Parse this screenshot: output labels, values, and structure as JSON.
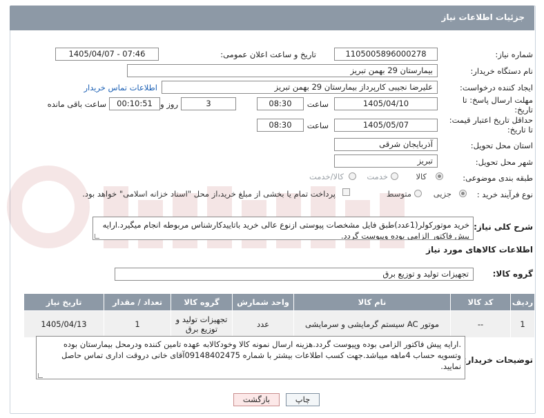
{
  "header": {
    "title": "جزئیات اطلاعات نیاز"
  },
  "form": {
    "need_number": {
      "label": "شماره نیاز:",
      "value": "1105005896000278"
    },
    "announce_datetime": {
      "label": "تاریخ و ساعت اعلان عمومی:",
      "value": "1405/04/07 - 07:46"
    },
    "buyer_device": {
      "label": "نام دستگاه خریدار:",
      "value": "بیمارستان 29 بهمن تبریز"
    },
    "requester": {
      "label": "ایجاد کننده درخواست:",
      "value": "علیرضا نجیبی کارپرداز بیمارستان 29 بهمن تبریز",
      "contact_link": "اطلاعات تماس خریدار"
    },
    "reply_deadline": {
      "label_line1": "مهلت ارسال پاسخ: تا",
      "label_line2": "تاریخ:",
      "date": "1405/04/10",
      "time_label": "ساعت",
      "time": "08:30",
      "days": "3",
      "days_label": "روز و",
      "remaining": "00:10:51",
      "remaining_label": "ساعت باقی مانده"
    },
    "price_validity": {
      "label_line1": "حداقل تاریخ اعتبار قیمت:",
      "label_line2": "تا تاریخ:",
      "date": "1405/05/07",
      "time_label": "ساعت",
      "time": "08:30"
    },
    "delivery_province": {
      "label": "استان محل تحویل:",
      "value": "آذربایجان شرقی"
    },
    "delivery_city": {
      "label": "شهر محل تحویل:",
      "value": "تبریز"
    },
    "category": {
      "label": "طبقه بندی موضوعی:",
      "options": [
        "کالا",
        "خدمت",
        "کالا/خدمت"
      ],
      "selected": "کالا"
    },
    "purchase_process": {
      "label": "نوع فرآیند خرید :",
      "options": [
        "جزیی",
        "متوسط"
      ],
      "selected": "جزیی",
      "payment_note": "پرداخت تمام یا بخشی از مبلغ خرید،از محل \"اسناد خزانه اسلامی\" خواهد بود."
    }
  },
  "general_description": {
    "label": "شرح کلی نیاز:",
    "text": "خرید موتورکولر(1عدد)طبق فایل مشخصات پیوستی ازنوع عالی خرید باتاییدکارشناس مربوطه انجام میگیرد.ارایه پیش فاکتور الزامی بوده وپیوست گردد."
  },
  "items_section": {
    "title": "اطلاعات کالاهای مورد نیاز",
    "group_label": "گروه کالا:",
    "group_value": "تجهیزات تولید و توزیع برق"
  },
  "table": {
    "headers": [
      "ردیف",
      "کد کالا",
      "نام کالا",
      "واحد شمارش",
      "گروه کالا",
      "تعداد / مقدار",
      "تاریخ نیاز"
    ],
    "rows": [
      [
        "1",
        "--",
        "موتور AC سیستم گرمایشی و سرمایشی",
        "عدد",
        "تجهیزات تولید و توزیع برق",
        "1",
        "1405/04/13"
      ]
    ]
  },
  "buyer_notes": {
    "label": "توضیحات خریدار:",
    "text": ".ارایه پیش فاکتور الزامی بوده وپیوست گردد.هزینه ارسال نمونه کالا وخودکالابه عهده تامین کننده ودرمحل بیمارستان بوده وتسویه حساب 4ماهه میباشد.جهت کسب اطلاعات بیشتر با شماره 09148402475آقای خانی دروقت اداری تماس حاصل نمایید."
  },
  "buttons": {
    "print": "چاپ",
    "back": "بازگشت"
  },
  "colors": {
    "header": "#8d99a6",
    "link": "#1a5fb4",
    "back_button_bg": "#fce8e8"
  }
}
